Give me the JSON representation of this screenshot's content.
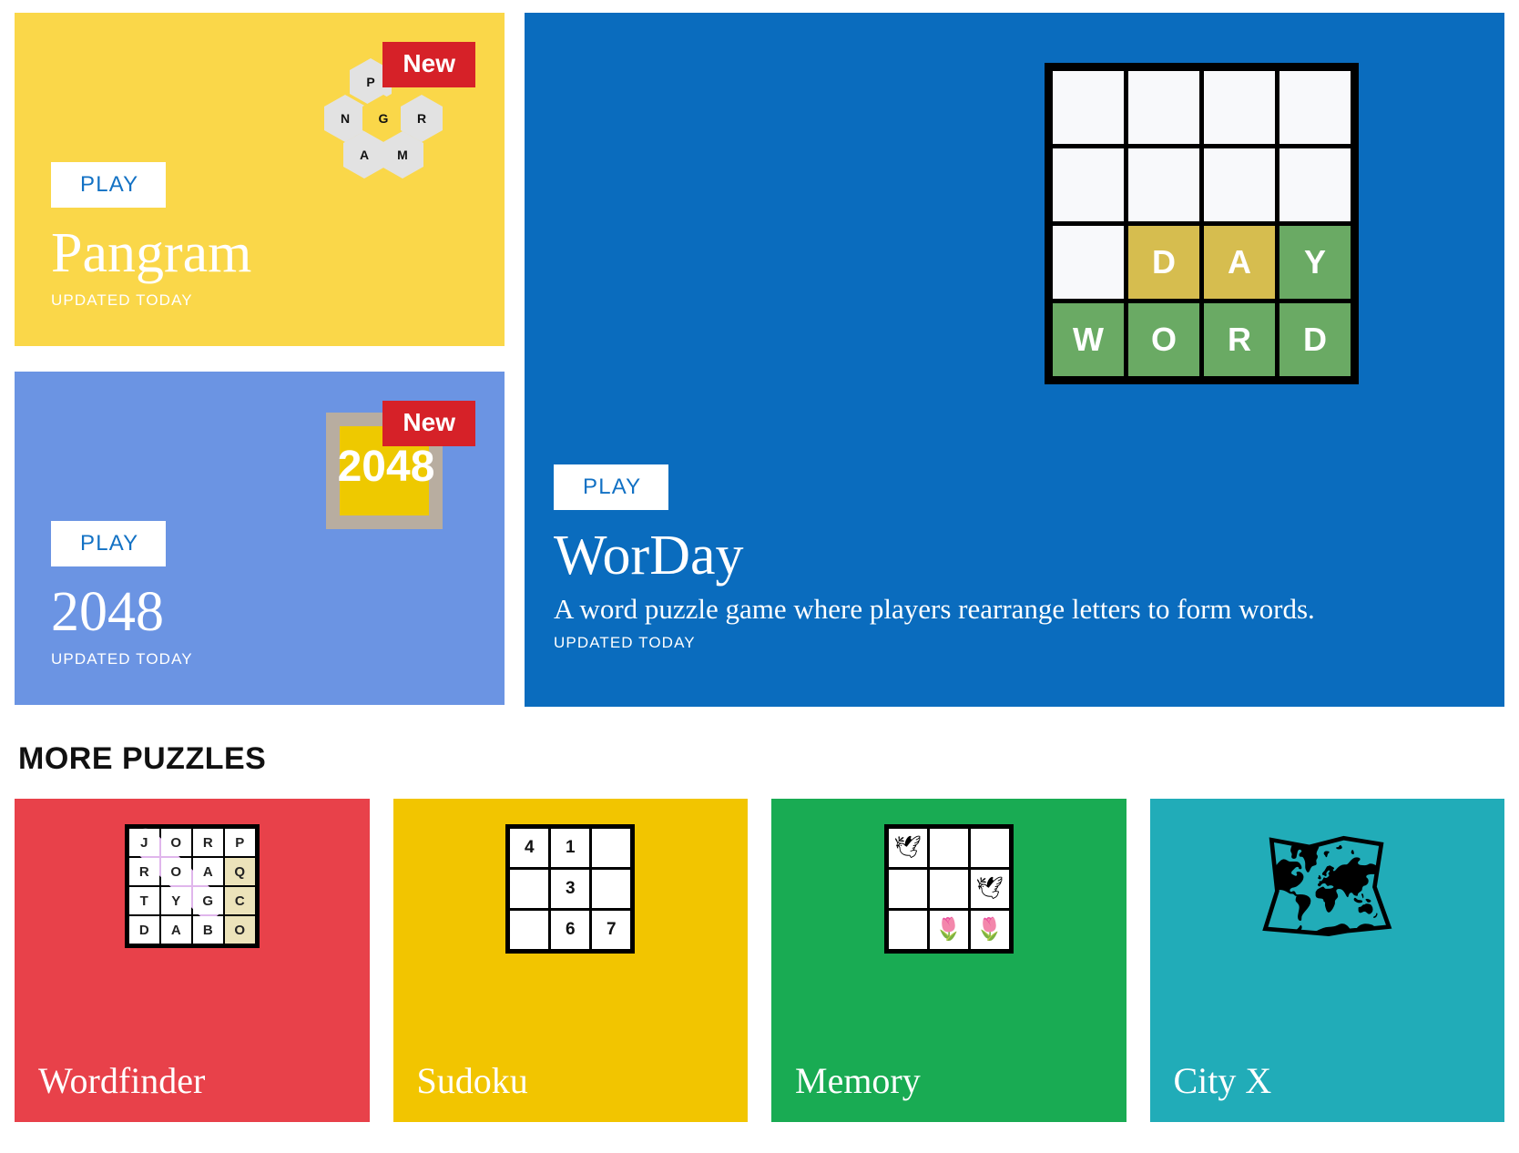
{
  "featured": {
    "pangram": {
      "badge": "New",
      "play_label": "PLAY",
      "title": "Pangram",
      "meta": "UPDATED TODAY",
      "bg_color": "#fad749",
      "hex_letters": [
        "P",
        "N",
        "G",
        "R",
        "A",
        "M"
      ]
    },
    "g2048": {
      "badge": "New",
      "play_label": "PLAY",
      "title": "2048",
      "meta": "UPDATED TODAY",
      "tile_number": "2048",
      "bg_color": "#6b94e3"
    },
    "worday": {
      "play_label": "PLAY",
      "title": "WorDay",
      "description": "A word puzzle game where players rearrange letters to form words.",
      "meta": "UPDATED TODAY",
      "bg_color": "#0a6cbe",
      "grid": [
        [
          {
            "letter": "",
            "state": "empty"
          },
          {
            "letter": "",
            "state": "empty"
          },
          {
            "letter": "",
            "state": "empty"
          },
          {
            "letter": "",
            "state": "empty"
          }
        ],
        [
          {
            "letter": "",
            "state": "empty"
          },
          {
            "letter": "",
            "state": "empty"
          },
          {
            "letter": "",
            "state": "empty"
          },
          {
            "letter": "",
            "state": "empty"
          }
        ],
        [
          {
            "letter": "",
            "state": "empty"
          },
          {
            "letter": "D",
            "state": "yellow"
          },
          {
            "letter": "A",
            "state": "yellow"
          },
          {
            "letter": "Y",
            "state": "green"
          }
        ],
        [
          {
            "letter": "W",
            "state": "green"
          },
          {
            "letter": "O",
            "state": "green"
          },
          {
            "letter": "R",
            "state": "green"
          },
          {
            "letter": "D",
            "state": "green"
          }
        ]
      ],
      "colors": {
        "yellow": "#d6bd4f",
        "green": "#6aaa64",
        "empty": "#f8f9fb"
      }
    }
  },
  "more_puzzles": {
    "heading": "MORE PUZZLES",
    "cards": [
      {
        "title": "Wordfinder",
        "bg_color": "#e8414a",
        "grid": [
          [
            "J",
            "O",
            "R",
            "P"
          ],
          [
            "R",
            "O",
            "A",
            "Q"
          ],
          [
            "T",
            "Y",
            "G",
            "C"
          ],
          [
            "D",
            "A",
            "B",
            "O"
          ]
        ],
        "highlight_color": "#e0b6ec",
        "column_highlight_color": "#ece3ba"
      },
      {
        "title": "Sudoku",
        "bg_color": "#f2c500",
        "grid": [
          [
            "4",
            "1",
            ""
          ],
          [
            "",
            "3",
            ""
          ],
          [
            "",
            "6",
            "7"
          ]
        ]
      },
      {
        "title": "Memory",
        "bg_color": "#19ab53",
        "grid": [
          [
            "bird",
            "",
            ""
          ],
          [
            "",
            "",
            "bird"
          ],
          [
            "",
            "tulip",
            "tulip"
          ]
        ],
        "icons": {
          "bird": "🕊",
          "tulip": "🌷"
        }
      },
      {
        "title": "City X",
        "bg_color": "#21acb8",
        "icon": "🗺"
      }
    ]
  }
}
